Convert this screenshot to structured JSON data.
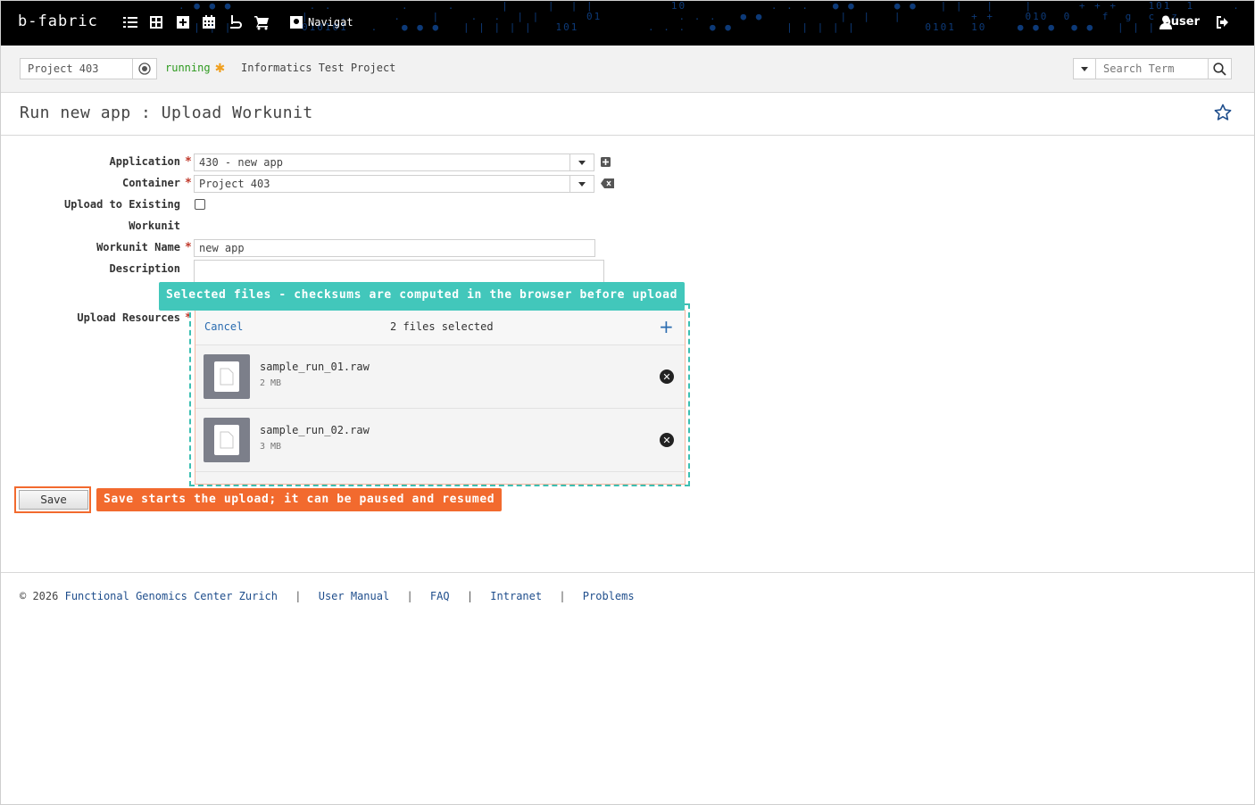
{
  "topbar": {
    "logo": "b-fabric",
    "nav_label": "Navigat",
    "user": "buser",
    "icons": [
      "list-icon",
      "grid-icon",
      "plus-square-icon",
      "calendar-icon",
      "import-icon",
      "cart-icon",
      "search-nav-icon",
      "user-icon",
      "logout-icon"
    ],
    "bg_color": "#000000"
  },
  "projectbar": {
    "project_value": "Project 403",
    "status": "running",
    "project_name": "Informatics Test Project",
    "search_placeholder": "Search Term",
    "status_color": "#2e9a1f"
  },
  "page": {
    "title": "Run new app : Upload Workunit"
  },
  "form": {
    "application_label": "Application",
    "application_value": "430 - new app",
    "container_label": "Container",
    "container_value": "Project 403",
    "upload_existing_label": "Upload to Existing",
    "workunit_label": "Workunit",
    "workunit_name_label": "Workunit Name",
    "workunit_name_value": "new app",
    "description_label": "Description",
    "upload_resources_label": "Upload Resources",
    "required_marker": "*"
  },
  "uploader": {
    "cancel_label": "Cancel",
    "selected_count": "2 files selected",
    "add_label": "+",
    "files": [
      {
        "name": "sample_run_01.raw",
        "size": "2 MB"
      },
      {
        "name": "sample_run_02.raw",
        "size": "3 MB"
      }
    ]
  },
  "callouts": {
    "files_note": "Selected files - checksums are computed in the browser before upload",
    "save_note": "Save starts the upload; it can be paused and resumed",
    "teal_color": "#42c7bb",
    "orange_color": "#f26a2e"
  },
  "actions": {
    "save_label": "Save"
  },
  "footer": {
    "copyright": "© 2026",
    "org_link": "Functional Genomics Center Zurich",
    "links": [
      "User Manual",
      "FAQ",
      "Intranet",
      "Problems"
    ],
    "separator": "|"
  }
}
